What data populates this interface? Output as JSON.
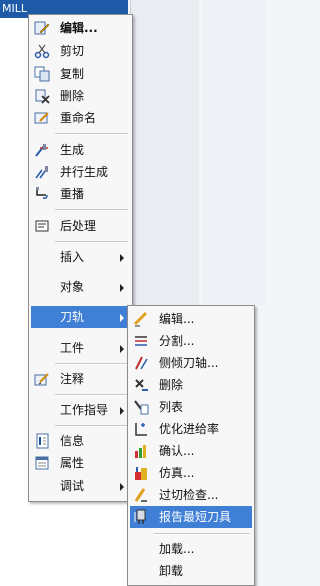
{
  "tree": {
    "header_text": "MILL"
  },
  "menu": {
    "items": [
      {
        "label": "编辑...",
        "icon": "edit-icon"
      },
      {
        "label": "剪切",
        "icon": "cut-icon"
      },
      {
        "label": "复制",
        "icon": "copy-icon"
      },
      {
        "label": "删除",
        "icon": "delete-icon"
      },
      {
        "label": "重命名",
        "icon": "rename-icon"
      },
      {
        "label": "生成",
        "icon": "generate-icon"
      },
      {
        "label": "并行生成",
        "icon": "parallel-generate-icon"
      },
      {
        "label": "重播",
        "icon": "replay-icon"
      },
      {
        "label": "后处理",
        "icon": "postprocess-icon"
      },
      {
        "label": "插入"
      },
      {
        "label": "对象"
      },
      {
        "label": "刀轨"
      },
      {
        "label": "工件"
      },
      {
        "label": "注释",
        "icon": "annotation-icon"
      },
      {
        "label": "工作指导"
      },
      {
        "label": "信息",
        "icon": "info-icon"
      },
      {
        "label": "属性",
        "icon": "properties-icon"
      },
      {
        "label": "调试"
      }
    ]
  },
  "submenu": {
    "items": [
      {
        "label": "编辑...",
        "icon": "edit-toolpath-icon"
      },
      {
        "label": "分割...",
        "icon": "split-icon"
      },
      {
        "label": "侧倾刀轴...",
        "icon": "tilt-axis-icon"
      },
      {
        "label": "删除",
        "icon": "delete-toolpath-icon"
      },
      {
        "label": "列表",
        "icon": "list-icon"
      },
      {
        "label": "优化进给率",
        "icon": "optimize-feed-icon"
      },
      {
        "label": "确认...",
        "icon": "verify-icon"
      },
      {
        "label": "仿真...",
        "icon": "simulate-icon"
      },
      {
        "label": "过切检查...",
        "icon": "gouge-check-icon"
      },
      {
        "label": "报告最短刀具",
        "icon": "report-shortest-tool-icon"
      },
      {
        "label": "加载..."
      },
      {
        "label": "卸载"
      }
    ]
  },
  "colors": {
    "highlight": "#3f7fd6",
    "menu_bg": "#f7f7f7",
    "tree_header": "#1e5aa8"
  }
}
